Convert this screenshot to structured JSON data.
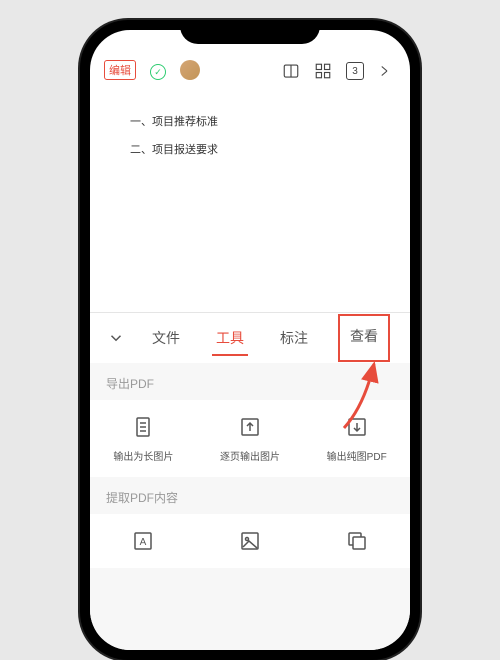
{
  "toolbar": {
    "edit_label": "编辑",
    "page_number": "3"
  },
  "document": {
    "line1": "一、项目推荐标准",
    "line2": "二、项目报送要求"
  },
  "tabs": {
    "file": "文件",
    "tools": "工具",
    "annotate": "标注",
    "view": "查看"
  },
  "sections": {
    "export_pdf": "导出PDF",
    "extract_pdf": "提取PDF内容"
  },
  "actions": {
    "export_long_image": "输出为长图片",
    "export_per_page": "逐页输出图片",
    "export_pure_pdf": "输出纯图PDF"
  }
}
